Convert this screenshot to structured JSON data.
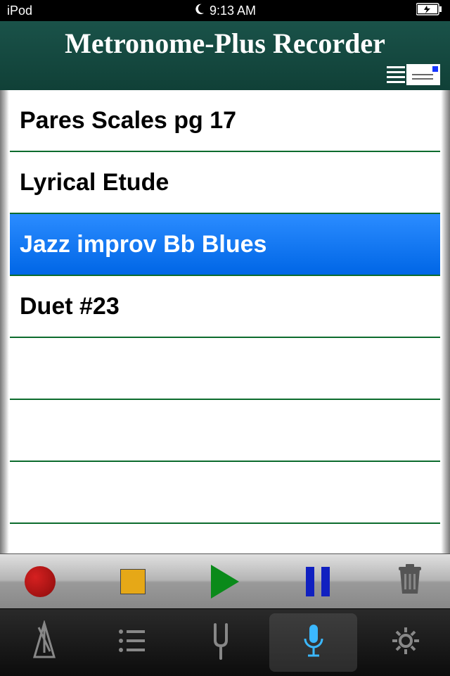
{
  "status": {
    "device": "iPod",
    "time": "9:13 AM"
  },
  "header": {
    "title": "Metronome-Plus Recorder"
  },
  "recordings": [
    {
      "title": "Pares Scales pg 17",
      "selected": false
    },
    {
      "title": "Lyrical Etude",
      "selected": false
    },
    {
      "title": "Jazz improv Bb Blues",
      "selected": true
    },
    {
      "title": "Duet #23",
      "selected": false
    }
  ],
  "emptyRows": 3,
  "transport": {
    "record": "record",
    "stop": "stop",
    "play": "play",
    "pause": "pause",
    "delete": "delete"
  },
  "tabs": {
    "metronome": "metronome",
    "list": "list",
    "tuner": "tuner",
    "recorder": "recorder",
    "settings": "settings",
    "active": "recorder"
  }
}
